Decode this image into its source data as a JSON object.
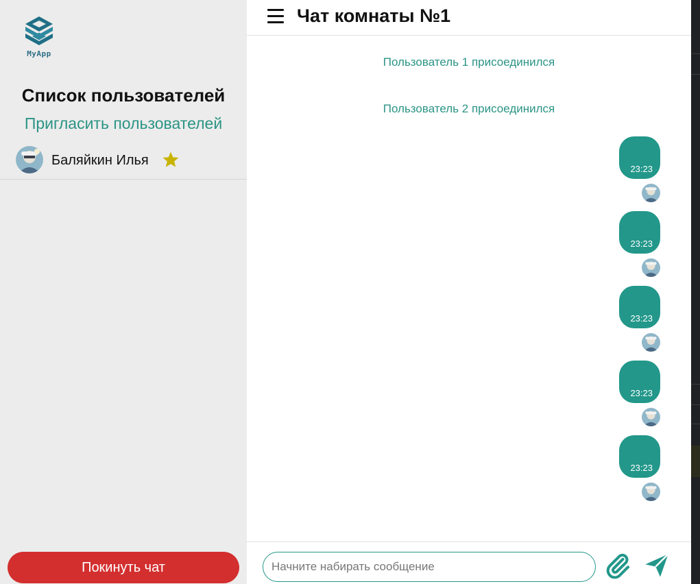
{
  "app": {
    "logo_text": "MyApp"
  },
  "sidebar": {
    "title": "Список пользователей",
    "invite_label": "Пригласить пользователей",
    "users": [
      {
        "name": "Баляйкин Илья",
        "badge": "star-icon",
        "badge_color": "#c8b400"
      }
    ],
    "leave_label": "Покинуть чат"
  },
  "chat": {
    "title": "Чат комнаты №1",
    "system_messages": [
      "Пользователь 1 присоединился",
      "Пользователь 2 присоединился"
    ],
    "messages": [
      {
        "time": "23:23"
      },
      {
        "time": "23:23"
      },
      {
        "time": "23:23"
      },
      {
        "time": "23:23"
      },
      {
        "time": "23:23"
      }
    ],
    "input": {
      "placeholder": "Начните набирать сообщение",
      "value": ""
    }
  },
  "colors": {
    "accent": "#22978a",
    "danger": "#d32f2f",
    "sidebar_bg": "#ececec",
    "link": "#2b9485"
  }
}
